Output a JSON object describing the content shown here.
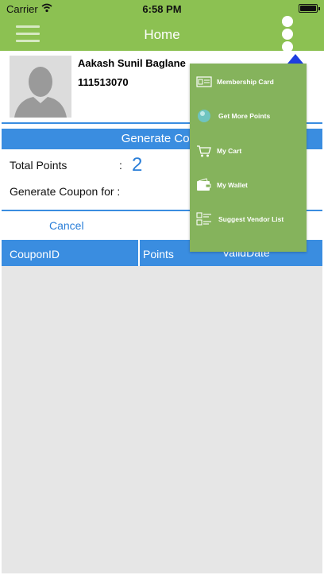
{
  "status_bar": {
    "carrier": "Carrier",
    "time": "6:58 PM"
  },
  "nav": {
    "title": "Home"
  },
  "profile": {
    "name": "Aakash Sunil Baglane",
    "id": "111513070"
  },
  "coupon_section": {
    "header": "Generate Coup",
    "total_points_label": "Total Points",
    "colon": ":",
    "total_points_value": "2",
    "generate_for_label": "Generate Coupon for :",
    "cancel_label": "Cancel"
  },
  "table": {
    "columns": [
      "CouponID",
      "Points",
      "ValidDate"
    ]
  },
  "menu": {
    "items": [
      {
        "label": "Membership Card",
        "icon": "membership-card-icon"
      },
      {
        "label": "Get More Points",
        "icon": "points-orb-icon"
      },
      {
        "label": "My Cart",
        "icon": "cart-icon"
      },
      {
        "label": "My Wallet",
        "icon": "wallet-icon"
      },
      {
        "label": "Suggest Vendor List",
        "icon": "vendor-list-icon"
      }
    ]
  },
  "colors": {
    "nav_green": "#8cc152",
    "primary_blue": "#3a8de0",
    "menu_green": "#85b35c",
    "arrow_blue": "#1f3fe0"
  }
}
